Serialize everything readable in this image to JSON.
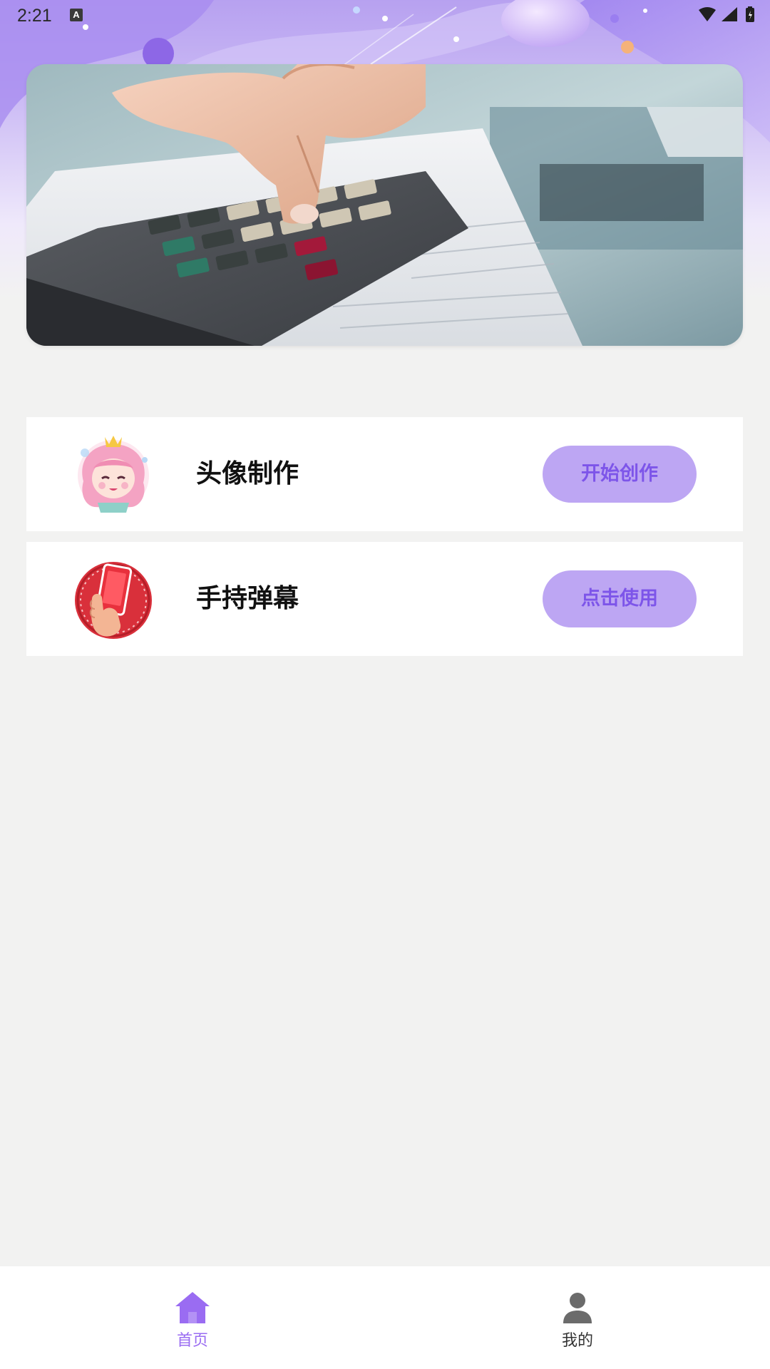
{
  "status_bar": {
    "time": "2:21",
    "notification_letter": "A",
    "icons": [
      "wifi-icon",
      "signal-icon",
      "battery-icon"
    ]
  },
  "banner": {
    "image": "calculator-photo"
  },
  "features": [
    {
      "title": "头像制作",
      "button_label": "开始创作",
      "icon": "anime-girl-avatar-icon"
    },
    {
      "title": "手持弹幕",
      "button_label": "点击使用",
      "icon": "hand-holding-phone-icon"
    }
  ],
  "bottom_nav": {
    "items": [
      {
        "label": "首页",
        "icon": "home-icon",
        "active": true
      },
      {
        "label": "我的",
        "icon": "person-icon",
        "active": false
      }
    ]
  },
  "colors": {
    "accent": "#9a6cf2",
    "button_bg": "#bda6f3",
    "button_text": "#7d55e9",
    "page_bg": "#f2f2f1",
    "card_bg": "#ffffff"
  }
}
